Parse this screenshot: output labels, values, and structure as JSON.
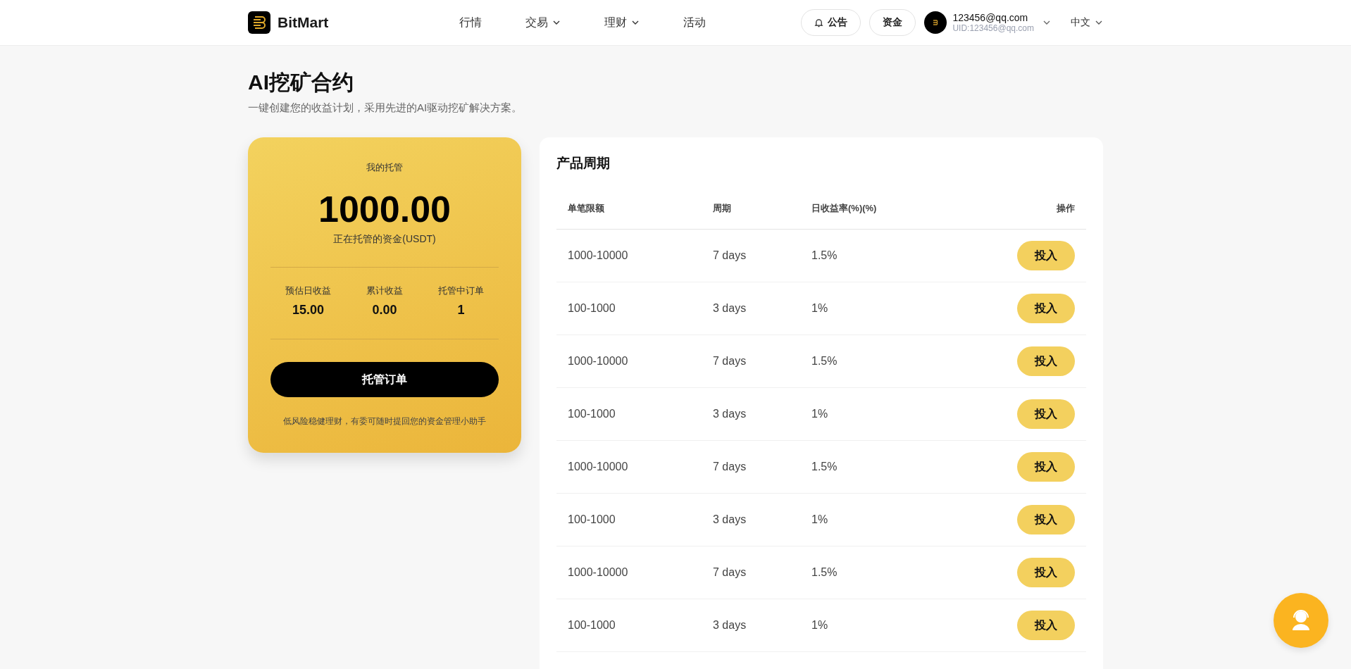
{
  "header": {
    "brand": "BitMart",
    "nav": [
      {
        "label": "行情",
        "dropdown": false
      },
      {
        "label": "交易",
        "dropdown": true
      },
      {
        "label": "理财",
        "dropdown": true
      },
      {
        "label": "活动",
        "dropdown": false
      }
    ],
    "notice_button": "公告",
    "funds_button": "资金",
    "user": {
      "email": "123456@qq.com",
      "uid": "UID:123456@qq.com"
    },
    "language": "中文"
  },
  "page": {
    "title": "AI挖矿合约",
    "subtitle": "一键创建您的收益计划，采用先进的AI驱动挖矿解决方案。"
  },
  "custody_card": {
    "label": "我的托管",
    "amount": "1000.00",
    "amount_caption": "正在托管的资金(USDT)",
    "stats": [
      {
        "label": "预估日收益",
        "value": "15.00"
      },
      {
        "label": "累计收益",
        "value": "0.00"
      },
      {
        "label": "托管中订单",
        "value": "1"
      }
    ],
    "button": "托管订单",
    "note": "低风险稳健理财，有委可随时提回您的资金管理小助手"
  },
  "products": {
    "title": "产品周期",
    "columns": [
      "单笔限额",
      "周期",
      "日收益率(%)(%)",
      "操作"
    ],
    "rows": [
      {
        "limit": "1000-10000",
        "period": "7 days",
        "rate": "1.5%",
        "action": "投入"
      },
      {
        "limit": "100-1000",
        "period": "3 days",
        "rate": "1%",
        "action": "投入"
      },
      {
        "limit": "1000-10000",
        "period": "7 days",
        "rate": "1.5%",
        "action": "投入"
      },
      {
        "limit": "100-1000",
        "period": "3 days",
        "rate": "1%",
        "action": "投入"
      },
      {
        "limit": "1000-10000",
        "period": "7 days",
        "rate": "1.5%",
        "action": "投入"
      },
      {
        "limit": "100-1000",
        "period": "3 days",
        "rate": "1%",
        "action": "投入"
      },
      {
        "limit": "1000-10000",
        "period": "7 days",
        "rate": "1.5%",
        "action": "投入"
      },
      {
        "limit": "100-1000",
        "period": "3 days",
        "rate": "1%",
        "action": "投入"
      }
    ]
  }
}
